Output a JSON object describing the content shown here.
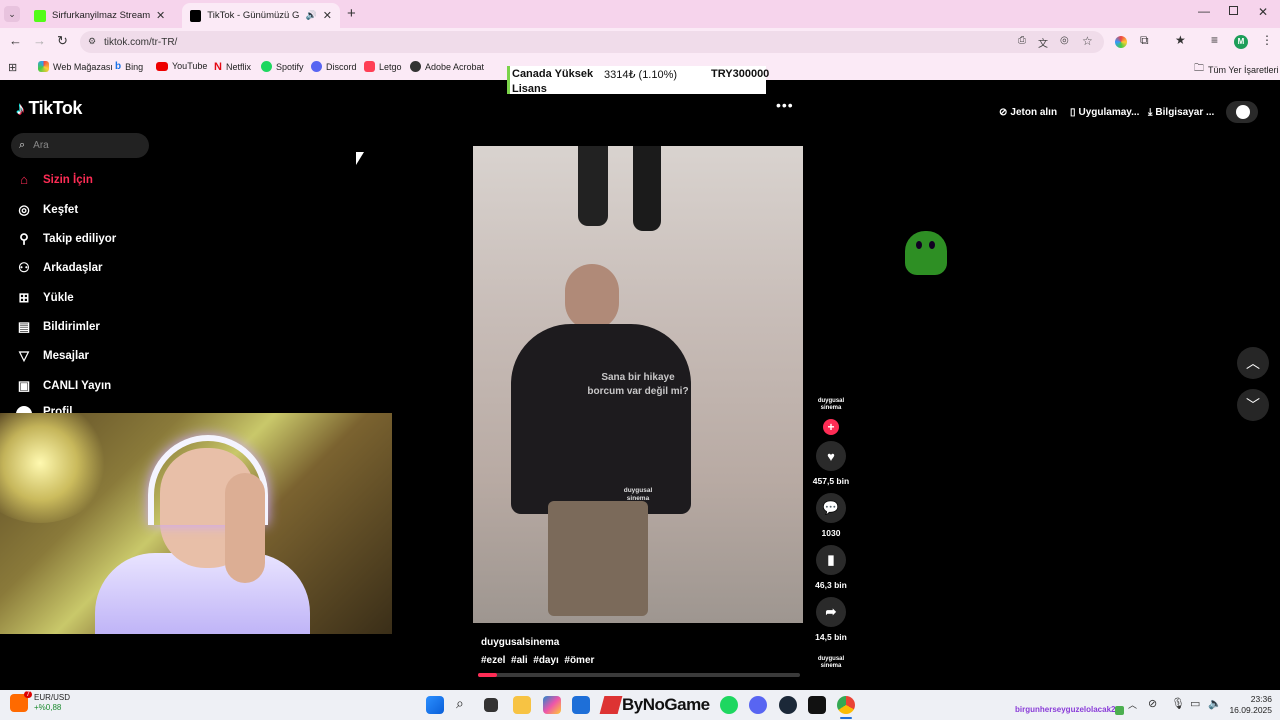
{
  "browser": {
    "tabs": [
      {
        "title": "Sirfurkanyilmaz Stream - Watch"
      },
      {
        "title": "TikTok - Günümüzü Güzelleş"
      }
    ],
    "url": "tiktok.com/tr-TR/",
    "bookmarks": [
      "Web Mağazası",
      "Bing",
      "YouTube",
      "Netflix",
      "Spotify",
      "Discord",
      "Letgo",
      "Adobe Acrobat"
    ],
    "all_bookmarks": "Tüm Yer İşaretleri",
    "profile_initial": "M"
  },
  "ticker": {
    "name_line1": "Canada Yüksek",
    "name_line2": "Lisans",
    "change": "3314₺ (1.10%)",
    "price": "TRY300000"
  },
  "tiktok": {
    "logo": "TikTok",
    "search_placeholder": "Ara",
    "nav": [
      "Sizin İçin",
      "Keşfet",
      "Takip ediliyor",
      "Arkadaşlar",
      "Yükle",
      "Bildirimler",
      "Mesajlar",
      "CANLI Yayın",
      "Profil"
    ],
    "header_buttons": {
      "coins": "Jeton alın",
      "app": "Uygulamay...",
      "computer": "Bilgisayar ..."
    },
    "video": {
      "subtitle_line1": "Sana bir hikaye",
      "subtitle_line2": "borcum var değil mi?",
      "watermark_line1": "duygusal",
      "watermark_line2": "sinema",
      "author": "duygusalsinema",
      "hashtags": "#ezel  #ali  #dayı  #ömer",
      "progress": 0.06
    },
    "actions": {
      "avatar_line1": "duygusal",
      "avatar_line2": "sinema",
      "likes": "457,5 bin",
      "comments": "1030",
      "saves": "46,3 bin",
      "shares": "14,5 bin"
    },
    "next_avatar_line1": "duygusal",
    "next_avatar_line2": "sinema"
  },
  "taskbar": {
    "widget_label": "EUR/USD",
    "widget_value": "+%0,88",
    "widget_badge": "7",
    "overlay_text": "ByNoGame",
    "stream_text": "birgunherseyguzelolacak26",
    "time": "23:36",
    "date": "16.09.2025"
  }
}
